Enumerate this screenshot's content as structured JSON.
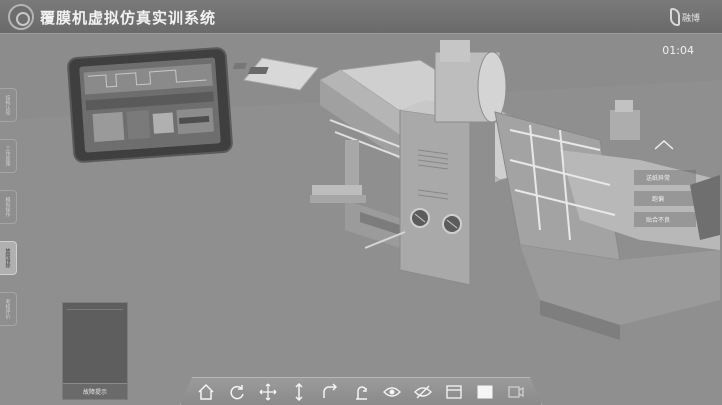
{
  "header": {
    "title": "覆膜机虚拟仿真实训系统",
    "brand_text": "融博"
  },
  "timer": "01:04",
  "menu": {
    "items": [
      {
        "label": "结构认知",
        "active": false
      },
      {
        "label": "工作原理",
        "active": false
      },
      {
        "label": "模拟操作",
        "active": false
      },
      {
        "label": "故障排除",
        "active": true
      },
      {
        "label": "考核评价",
        "active": false
      }
    ]
  },
  "hint_panel": {
    "button_label": "故障提示"
  },
  "fault_options": [
    "送纸异常",
    "跑偏",
    "贴合不良"
  ],
  "toolbar": {
    "tools": [
      {
        "icon": "home-icon"
      },
      {
        "icon": "rotate-icon"
      },
      {
        "icon": "move-icon"
      },
      {
        "icon": "vertical-move-icon"
      },
      {
        "icon": "undo-icon"
      },
      {
        "icon": "reset-view-icon"
      },
      {
        "icon": "eye-icon"
      },
      {
        "icon": "eye-off-icon"
      },
      {
        "icon": "window-icon"
      },
      {
        "icon": "fill-icon"
      },
      {
        "icon": "camera-icon"
      }
    ]
  },
  "colors": {
    "background": "#8a8a8a",
    "header": "#6a6a6a",
    "accent": "#b0b0b0"
  }
}
